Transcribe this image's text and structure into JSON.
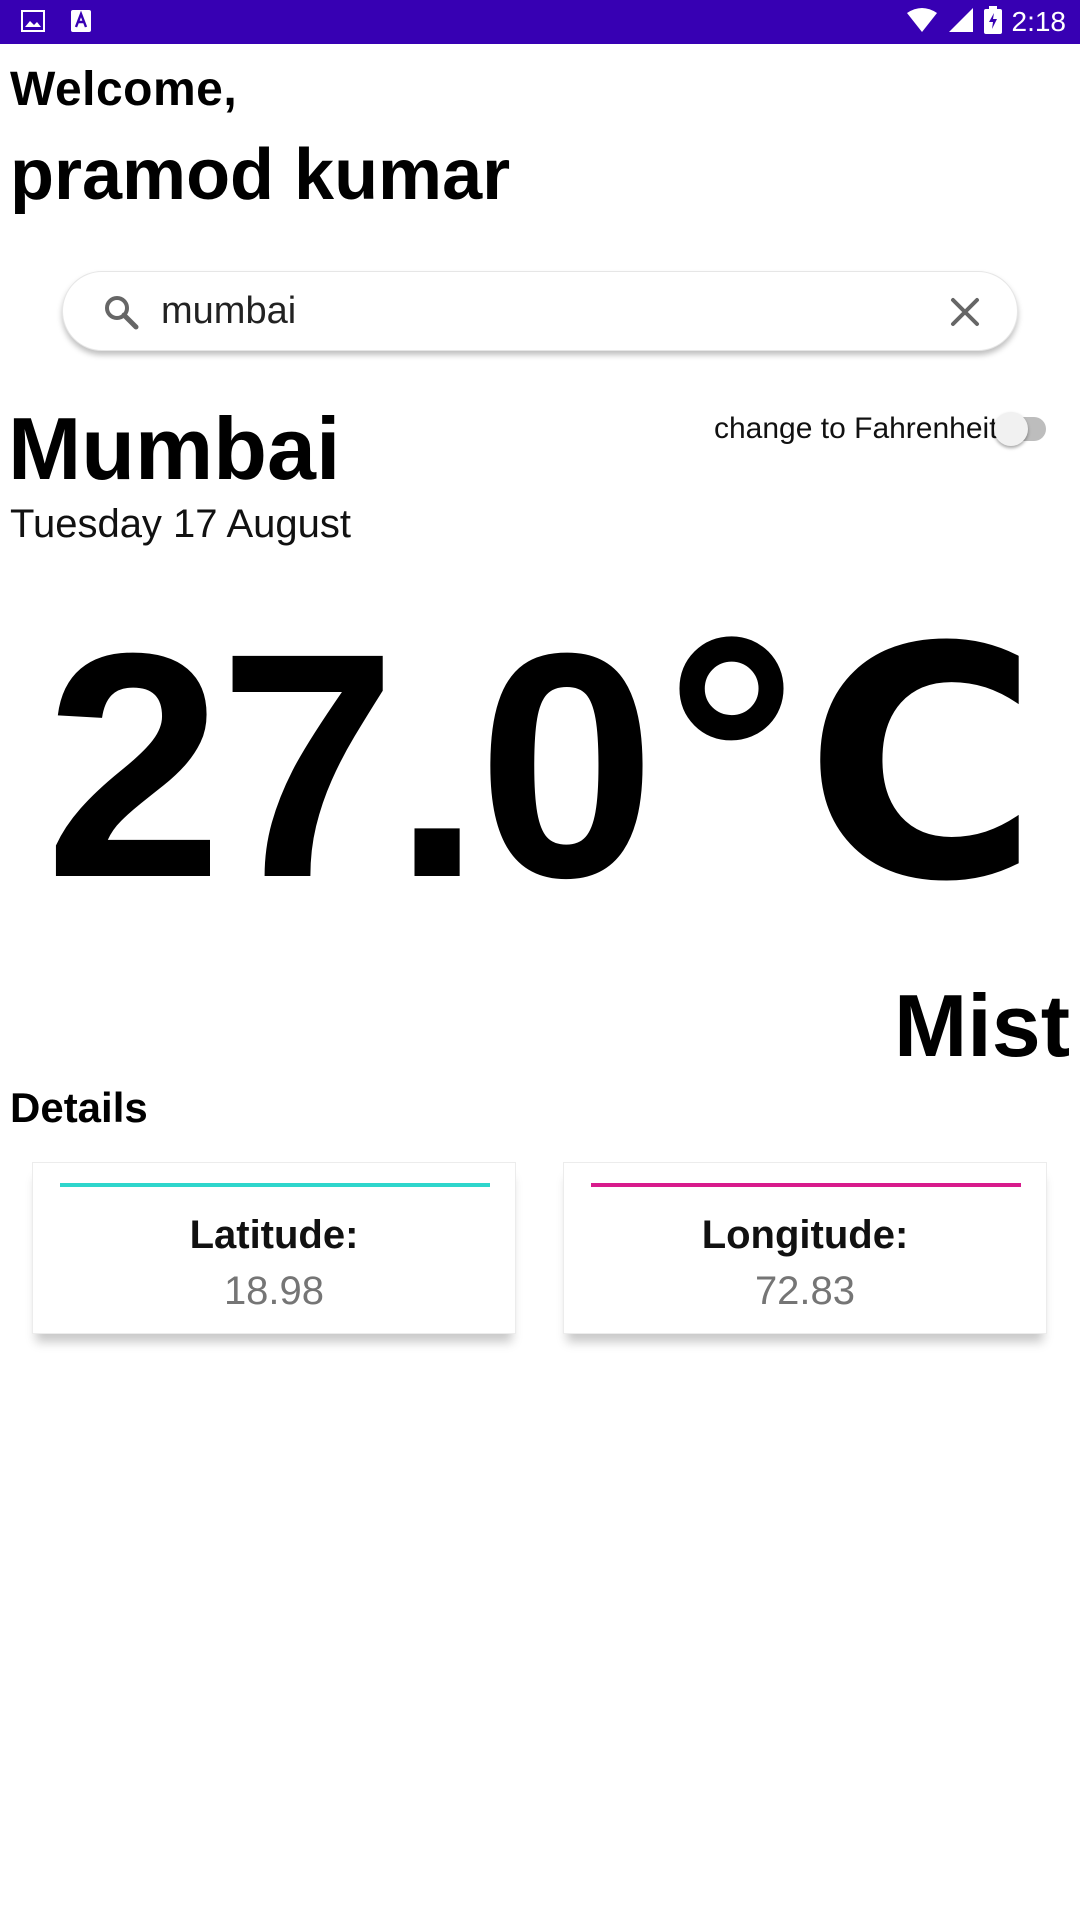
{
  "status_bar": {
    "time": "2:18",
    "icons": [
      "gallery-notification-icon",
      "a-notification-icon",
      "wifi-icon",
      "cell-signal-icon",
      "battery-charging-icon"
    ],
    "background": "#3700b3"
  },
  "greeting": {
    "welcome": "Welcome,",
    "name": "pramod kumar"
  },
  "search": {
    "value": "mumbai",
    "icon": "search-icon",
    "clear_icon": "close-icon"
  },
  "weather": {
    "city": "Mumbai",
    "date": "Tuesday  17 August",
    "unit_toggle_label": "change to Fahrenheit",
    "unit_toggle_on": false,
    "temperature": "27.0℃",
    "condition": "Mist"
  },
  "details": {
    "title": "Details",
    "cards": [
      {
        "label": "Latitude:",
        "value": "18.98",
        "accent": "#2ed6cc"
      },
      {
        "label": "Longitude:",
        "value": "72.83",
        "accent": "#d81b8c"
      }
    ]
  }
}
